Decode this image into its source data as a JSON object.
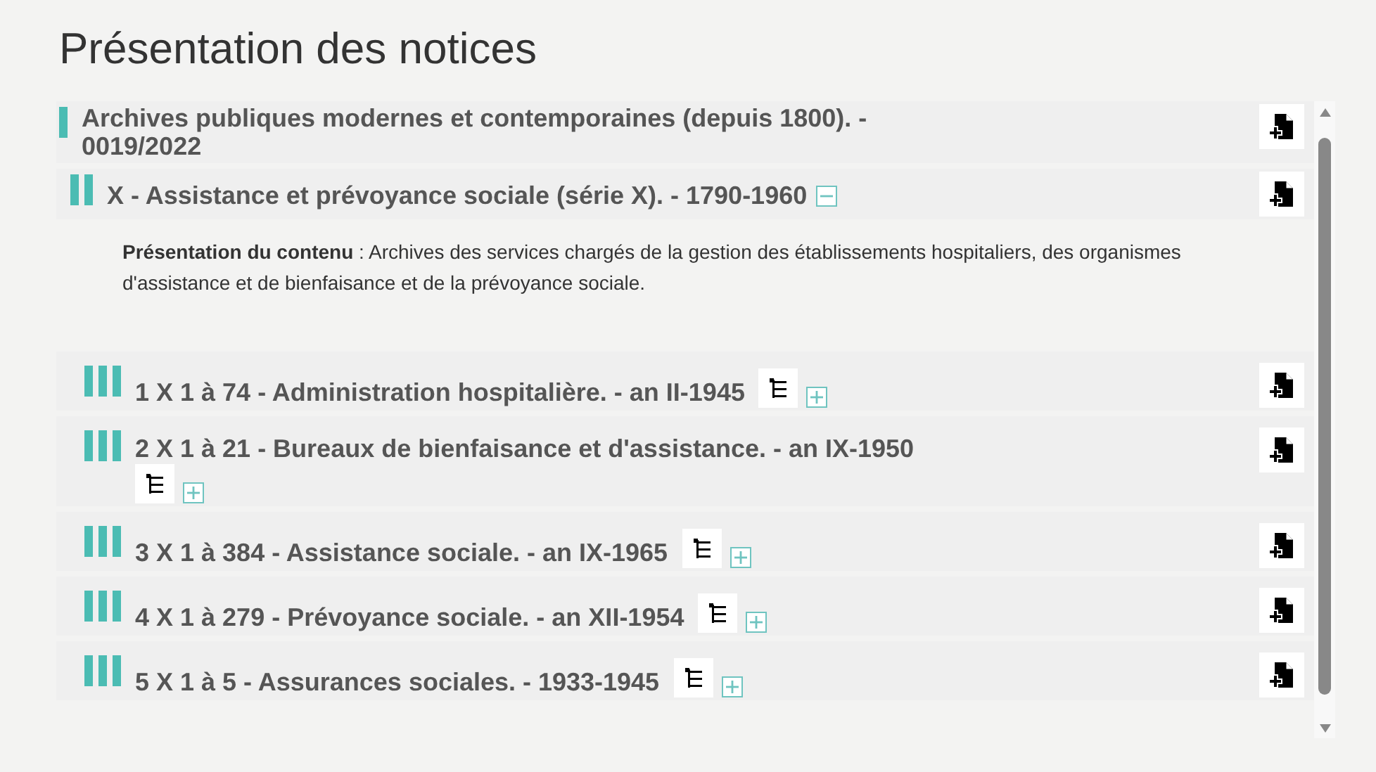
{
  "page_title": "Présentation des notices",
  "record": {
    "title": "Archives publiques modernes et contemporaines (depuis 1800). - 0019/2022",
    "children": [
      {
        "title": "X - Assistance et prévoyance sociale (série X). - 1790-1960",
        "expanded": true,
        "description": {
          "label": "Présentation du contenu",
          "text": ": Archives des services chargés de la gestion des établissements hospitaliers, des organismes d'assistance et de bienfaisance et de la prévoyance sociale."
        },
        "children": [
          {
            "title": "1 X 1 à 74 - Administration hospitalière. - an II-1945",
            "expanded": false
          },
          {
            "title": "2 X 1 à 21 - Bureaux de bienfaisance et d'assistance. - an IX-1950",
            "expanded": false
          },
          {
            "title": "3 X 1 à 384 - Assistance sociale. - an IX-1965",
            "expanded": false
          },
          {
            "title": "4 X 1 à 279 - Prévoyance sociale. - an XII-1954",
            "expanded": false
          },
          {
            "title": "5 X 1 à 5 - Assurances sociales. - 1933-1945",
            "expanded": false
          }
        ]
      }
    ]
  }
}
